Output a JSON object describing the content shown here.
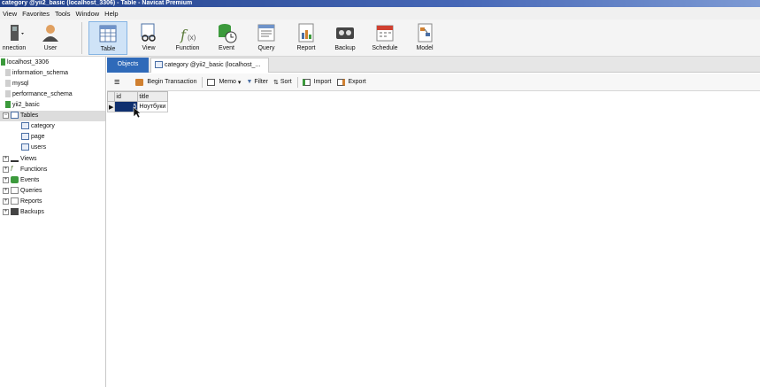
{
  "window": {
    "title": "category @yii2_basic (localhost_3306) - Table - Navicat Premium"
  },
  "menu": [
    "View",
    "Favorites",
    "Tools",
    "Window",
    "Help"
  ],
  "toolbar": {
    "connection": "nnection",
    "user": "User",
    "table": "Table",
    "view": "View",
    "function": "Function",
    "event": "Event",
    "query": "Query",
    "report": "Report",
    "backup": "Backup",
    "schedule": "Schedule",
    "model": "Model"
  },
  "sidebar": {
    "connection": "localhost_3306",
    "databases": [
      "information_schema",
      "mysql",
      "performance_schema",
      "yii2_basic"
    ],
    "tables_label": "Tables",
    "tables": [
      "category",
      "page",
      "users"
    ],
    "groups": [
      "Views",
      "Functions",
      "Events",
      "Queries",
      "Reports",
      "Backups"
    ]
  },
  "tabs": {
    "objects": "Objects",
    "table_tab": "category @yii2_basic (localhost_..."
  },
  "actions": {
    "begin_transaction": "Begin Transaction",
    "memo": "Memo",
    "filter": "Filter",
    "sort": "Sort",
    "import": "Import",
    "export": "Export"
  },
  "grid": {
    "columns": [
      "id",
      "title"
    ],
    "rows": [
      {
        "id": "5",
        "title": "Ноутбуки"
      }
    ]
  },
  "colors": {
    "accent": "#2f6ab9",
    "selected_cell": "#0f2f6e",
    "titlebar": "#21408a"
  }
}
